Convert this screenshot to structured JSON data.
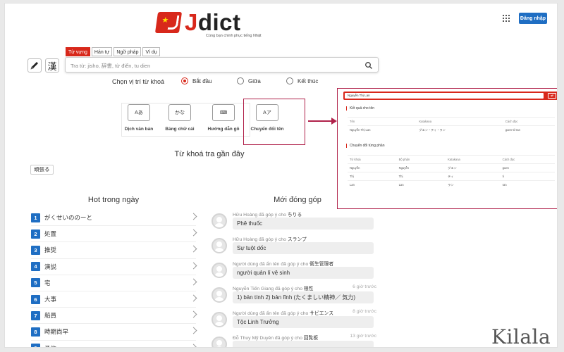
{
  "header": {
    "logo_letter": "J",
    "logo_rest": "dict",
    "logo_tagline": "Cùng bạn chinh phục tiếng Nhật",
    "login_label": "Đăng nhập"
  },
  "search": {
    "tabs": [
      "Từ vựng",
      "Hán tự",
      "Ngữ pháp",
      "Ví dụ"
    ],
    "active_tab": "Từ vựng",
    "placeholder": "Tra từ: jisho, 辞書, từ điển, tu dien",
    "handwrite_tool": "pen-icon",
    "kanji_tool_label": "漢"
  },
  "keyword_position": {
    "label": "Chọn vị trí từ khoá",
    "options": [
      "Bắt đầu",
      "Giữa",
      "Kết thúc"
    ],
    "selected": "Bắt đầu"
  },
  "features": [
    {
      "icon_text": "Aあ",
      "label": "Dịch văn bản"
    },
    {
      "icon_text": "かな",
      "label": "Bảng chữ cái"
    },
    {
      "icon_text": "⌨",
      "label": "Hướng dẫn gõ"
    },
    {
      "icon_text": "Aア",
      "label": "Chuyển đổi tên"
    }
  ],
  "name_converter_popup": {
    "input_value": "Nguyễn Thị Lan",
    "button_label": "⇄",
    "result_title": "Kết quả cho tên",
    "result_headers": [
      "Tên",
      "Katakana",
      "Cách đọc"
    ],
    "result_rows": [
      [
        "Nguyễn Thị Lan",
        "グエン・ティ・ラン",
        "guen-tii-ran"
      ]
    ],
    "parts_title": "Chuyển đổi từng phần",
    "parts_headers": [
      "Từ khoá",
      "Bộ phận",
      "Katakana",
      "Cách đọc"
    ],
    "parts_rows": [
      [
        "Nguyễn",
        "Nguyễn",
        "グエン",
        "guen"
      ],
      [
        "Thị",
        "Thị",
        "ティ",
        "ti"
      ],
      [
        "Lan",
        "Lan",
        "ラン",
        "ran"
      ]
    ]
  },
  "recent": {
    "title": "Từ khoá tra gần đây",
    "items": [
      "頑張る"
    ]
  },
  "hot_today": {
    "title": "Hot trong ngày",
    "items": [
      {
        "rank": "1",
        "word": "がくせいののーと"
      },
      {
        "rank": "2",
        "word": "処置"
      },
      {
        "rank": "3",
        "word": "推奨"
      },
      {
        "rank": "4",
        "word": "演説"
      },
      {
        "rank": "5",
        "word": "宅"
      },
      {
        "rank": "6",
        "word": "大事"
      },
      {
        "rank": "7",
        "word": "船員"
      },
      {
        "rank": "8",
        "word": "時期尚早"
      },
      {
        "rank": "9",
        "word": "予約"
      }
    ]
  },
  "contributions": {
    "title": "Mới đóng góp",
    "items": [
      {
        "user": "Hữu Hoàng đã góp ý cho",
        "word": "ちりる",
        "time": "",
        "text": "Phê thuốc"
      },
      {
        "user": "Hữu Hoàng đã góp ý cho",
        "word": "スランプ",
        "time": "",
        "text": "Sự tuột dốc"
      },
      {
        "user": "Người dùng đã ẩn tên đã góp ý cho",
        "word": "衛生管理者",
        "time": "",
        "text": "người quản lí vệ sinh"
      },
      {
        "user": "Nguyễn Tiến Giang đã góp ý cho",
        "word": "根性",
        "time": "6 giờ trước",
        "text": "1) bản tính 2) bản lĩnh (たくましい精神／ 気力)"
      },
      {
        "user": "Người dùng đã ẩn tên đã góp ý cho",
        "word": "サビエンス",
        "time": "8 giờ trước",
        "text": "Tộc Linh Trưởng"
      },
      {
        "user": "Đỗ Thuy Mỹ Duyên đã góp ý cho",
        "word": "回覧板",
        "time": "13 giờ trước",
        "text": ""
      }
    ]
  },
  "watermark": "Kilala",
  "colors": {
    "brand_red": "#d8281b",
    "primary_blue": "#1f6ec3",
    "annotation": "#b0214a"
  }
}
